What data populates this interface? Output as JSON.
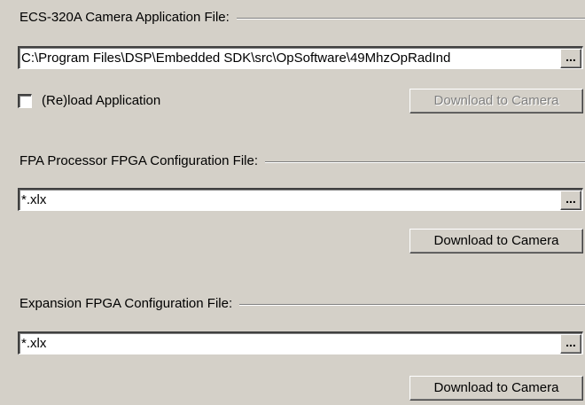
{
  "app_section": {
    "group_label": "ECS-320A Camera Application File:",
    "path_value": "C:\\Program Files\\DSP\\Embedded SDK\\src\\OpSoftware\\49MhzOpRadInd",
    "browse_label": "...",
    "reload_label": "(Re)load Application",
    "reload_checked": false,
    "download_label": "Download to Camera",
    "download_enabled": false
  },
  "fpa_section": {
    "group_label": "FPA Processor FPGA Configuration File:",
    "path_value": "*.xlx",
    "browse_label": "...",
    "download_label": "Download to Camera",
    "download_enabled": true
  },
  "expansion_section": {
    "group_label": "Expansion FPGA Configuration File:",
    "path_value": "*.xlx",
    "browse_label": "...",
    "download_label": "Download to Camera",
    "download_enabled": true
  }
}
